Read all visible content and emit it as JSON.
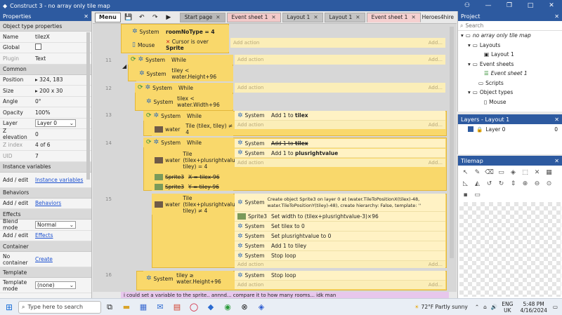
{
  "window": {
    "title": "Construct 3 - no array only tile map"
  },
  "properties": {
    "header": "Properties",
    "sections": {
      "object_type": "Object type properties",
      "common": "Common",
      "instance_vars": "Instance variables",
      "behaviors": "Behaviors",
      "effects": "Effects",
      "container": "Container",
      "template": "Template"
    },
    "name_label": "Name",
    "name_value": "tilezX",
    "global_label": "Global",
    "plugin_label": "Plugin",
    "plugin_value": "Text",
    "position_label": "Position",
    "position_value": "324, 183",
    "size_label": "Size",
    "size_value": "200 x 30",
    "angle_label": "Angle",
    "angle_value": "0°",
    "opacity_label": "Opacity",
    "opacity_value": "100%",
    "layer_label": "Layer",
    "layer_value": "Layer 0",
    "zelev_label": "Z elevation",
    "zelev_value": "0",
    "zindex_label": "Z index",
    "zindex_value": "4 of 6",
    "uid_label": "UID",
    "uid_value": "7",
    "addedit_label": "Add / edit",
    "instvars_link": "Instance variables",
    "behaviors_link": "Behaviors",
    "effects_link": "Effects",
    "blend_label": "Blend mode",
    "blend_value": "Normal",
    "nocontainer_label": "No container",
    "create_link": "Create",
    "template_label": "Template mode",
    "template_value": "(none)"
  },
  "toolbar": {
    "menu": "Menu",
    "tabs": [
      {
        "label": "Start page"
      },
      {
        "label": "Event sheet 1"
      },
      {
        "label": "Layout 1"
      },
      {
        "label": "Layout 1"
      },
      {
        "label": "Event sheet 1"
      }
    ],
    "user": "Heroes4hire"
  },
  "events": {
    "e0_obj1": "System",
    "e0_cond1": "roomNoType = 4",
    "e0_obj2": "Mouse",
    "e0_cond2": "Cursor is over",
    "e0_cond2b": "Sprite",
    "n11": "11",
    "e11_obj1": "System",
    "e11_cond1": "While",
    "e11_obj2": "System",
    "e11_cond2": "tiley < water.Height+96",
    "n12": "12",
    "e12_obj1": "System",
    "e12_cond1": "While",
    "e12_obj2": "System",
    "e12_cond2": "tilex < water.Width+96",
    "n13": "13",
    "e13_obj1": "System",
    "e13_cond1": "While",
    "e13_obj2": "water",
    "e13_cond2": "Tile (tilex, tiley) ≠ 4",
    "e13_act_obj": "System",
    "e13_act": "Add 1 to",
    "e13_act_var": "tilex",
    "n14": "14",
    "e14_obj1": "System",
    "e14_cond1": "While",
    "e14_obj2": "water",
    "e14_cond2": "Tile (tilex+plusrightvalue, tiley) = 4",
    "e14_obj3": "Sprite3",
    "e14_cond3": "X = tilex-96",
    "e14_obj4": "Sprite3",
    "e14_cond4": "Y = tiley-96",
    "e14_a1_obj": "System",
    "e14_a1": "Add 1 to",
    "e14_a1_var": "tilex",
    "e14_a2_obj": "System",
    "e14_a2": "Add 1 to",
    "e14_a2_var": "plusrightvalue",
    "n15": "15",
    "e15_obj1": "water",
    "e15_cond1": "Tile (tilex+plusrightvalue, tiley) ≠ 4",
    "e15_a1_obj": "System",
    "e15_a1": "Create object Sprite3 on layer 0 at (water.TileToPositionX(tilex)-48, water.TileToPositionY(tiley)-48), create hierarchy: False, template: ''",
    "e15_a2_obj": "Sprite3",
    "e15_a2": "Set width to (tilex+plusrightvalue-3)×96",
    "e15_a3_obj": "System",
    "e15_a3": "Set tilex to 0",
    "e15_a4_obj": "System",
    "e15_a4": "Set plusrightvalue to 0",
    "e15_a5_obj": "System",
    "e15_a5": "Add 1 to tiley",
    "e15_a6_obj": "System",
    "e15_a6": "Stop loop",
    "n16": "16",
    "e16_obj1": "System",
    "e16_cond1": "tiley ≥ water.Height+96",
    "e16_a1_obj": "System",
    "e16_a1": "Stop loop",
    "add_action": "Add action",
    "add_more": "Add...",
    "comment": "i could set a variable to the sprite.. annnd... compare it to how many rooms... idk man"
  },
  "project": {
    "header": "Project",
    "search_placeholder": "Search",
    "tree": [
      "no array only tile map",
      "Layouts",
      "Layout 1",
      "Event sheets",
      "Event sheet 1",
      "Scripts",
      "Object types",
      "Mouse"
    ]
  },
  "layers": {
    "header": "Layers - Layout 1",
    "layer_name": "Layer 0",
    "layer_index": "0"
  },
  "tilemap": {
    "header": "Tilemap"
  },
  "taskbar": {
    "search": "Type here to search",
    "weather": "72°F  Partly sunny",
    "lang": "ENG",
    "region": "UK",
    "time": "5:48 PM",
    "date": "4/16/2024"
  }
}
